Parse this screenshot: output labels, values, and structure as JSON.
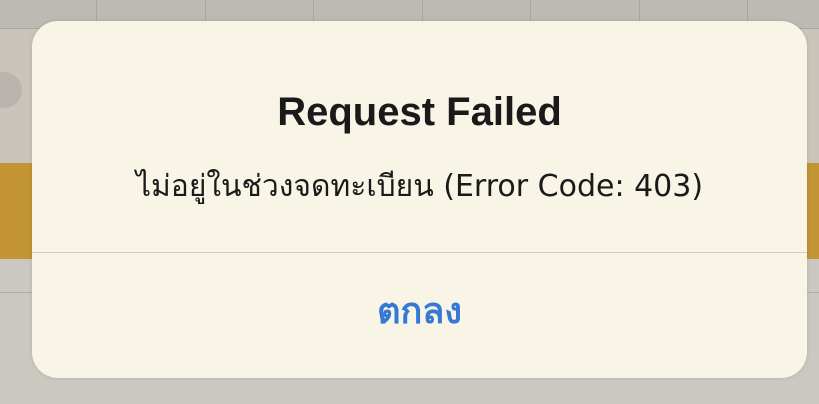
{
  "alert": {
    "title": "Request Failed",
    "message": "ไม่อยู่ในช่วงจดทะเบียน (Error Code: 403)",
    "button_label": "ตกลง"
  },
  "colors": {
    "dialog_background": "#f8f4e6",
    "button_text": "#3478d8",
    "background_accent": "#c39434"
  }
}
